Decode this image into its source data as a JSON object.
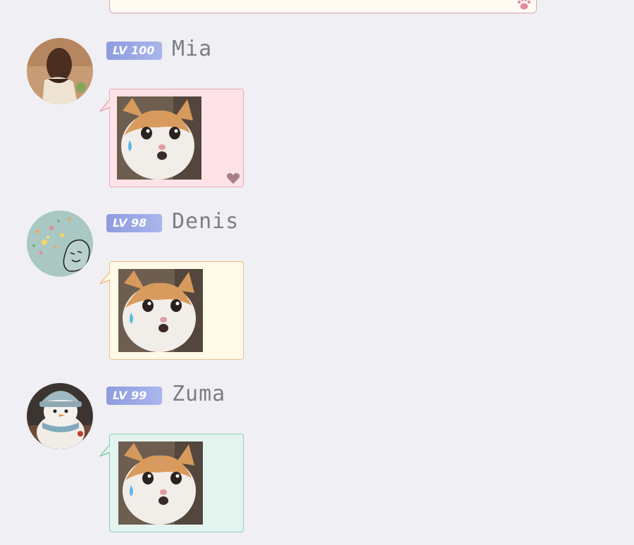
{
  "messages": [
    {
      "level": "LV 100",
      "name": "Mia",
      "bubble_bg": "#fde3e8",
      "bubble_border": "#e7a9b6",
      "sticker": "crying-cat-sticker",
      "decoration": "heart-icon"
    },
    {
      "level": "LV 98",
      "name": "Denis",
      "bubble_bg": "#fffae8",
      "bubble_border": "#efc186",
      "sticker": "crying-cat-sticker"
    },
    {
      "level": "LV 99",
      "name": "Zuma",
      "bubble_bg": "#e3f4ee",
      "bubble_border": "#8fcbb5",
      "sticker": "crying-cat-sticker"
    }
  ],
  "top_bubble": {
    "decoration": "paw-icon"
  },
  "colors": {
    "background": "#efeff4",
    "level_badge": "#8e9cdf",
    "name_text": "#7d7d85"
  }
}
